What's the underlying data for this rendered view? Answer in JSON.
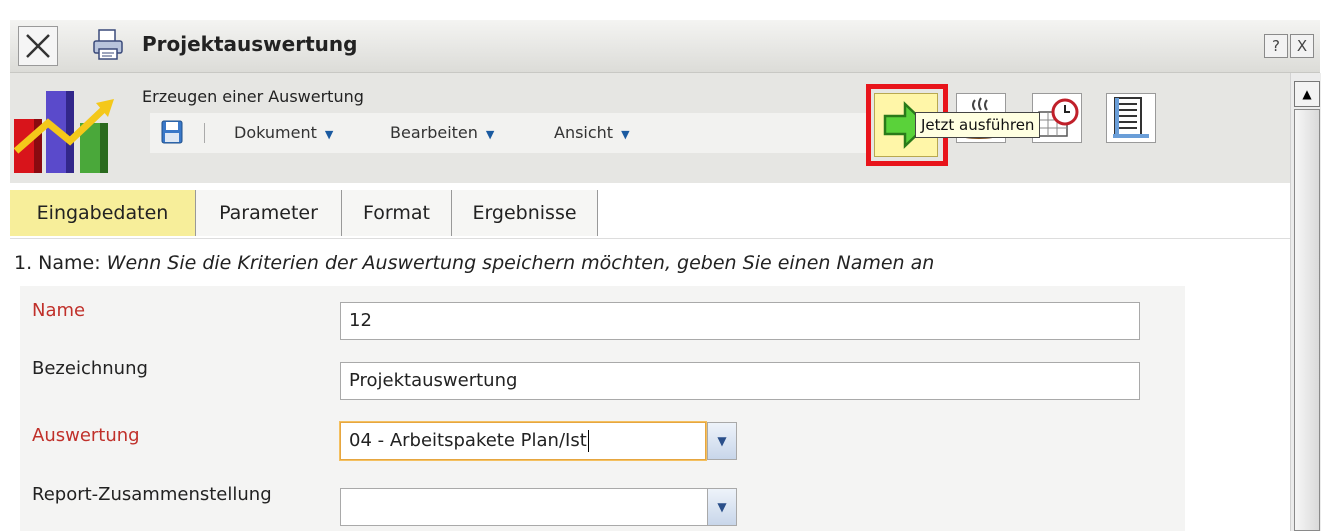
{
  "window": {
    "title": "Projektauswertung",
    "help_label": "?",
    "close_label": "X"
  },
  "toolbar": {
    "subtitle": "Erzeugen einer Auswertung",
    "menus": [
      "Dokument",
      "Bearbeiten",
      "Ansicht"
    ],
    "menu_arrow": "▼",
    "run_tooltip": "Jetzt ausführen",
    "highlight_color": "#e8141b"
  },
  "tabs": {
    "items": [
      "Eingabedaten",
      "Parameter",
      "Format",
      "Ergebnisse"
    ],
    "active": "Eingabedaten"
  },
  "section": {
    "prefix": "1. Name: ",
    "instruction": "Wenn Sie die Kriterien der Auswertung speichern möchten, geben Sie einen Namen an"
  },
  "form": {
    "name_label": "Name",
    "name_value": "12",
    "bezeichnung_label": "Bezeichnung",
    "bezeichnung_value": "Projektauswertung",
    "auswertung_label": "Auswertung",
    "auswertung_value": "04 - Arbeitspakete Plan/Ist",
    "report_label": "Report-Zusammenstellung",
    "report_value": ""
  },
  "colors": {
    "required_label": "#c0302a",
    "active_tab": "#f7ee9a"
  }
}
